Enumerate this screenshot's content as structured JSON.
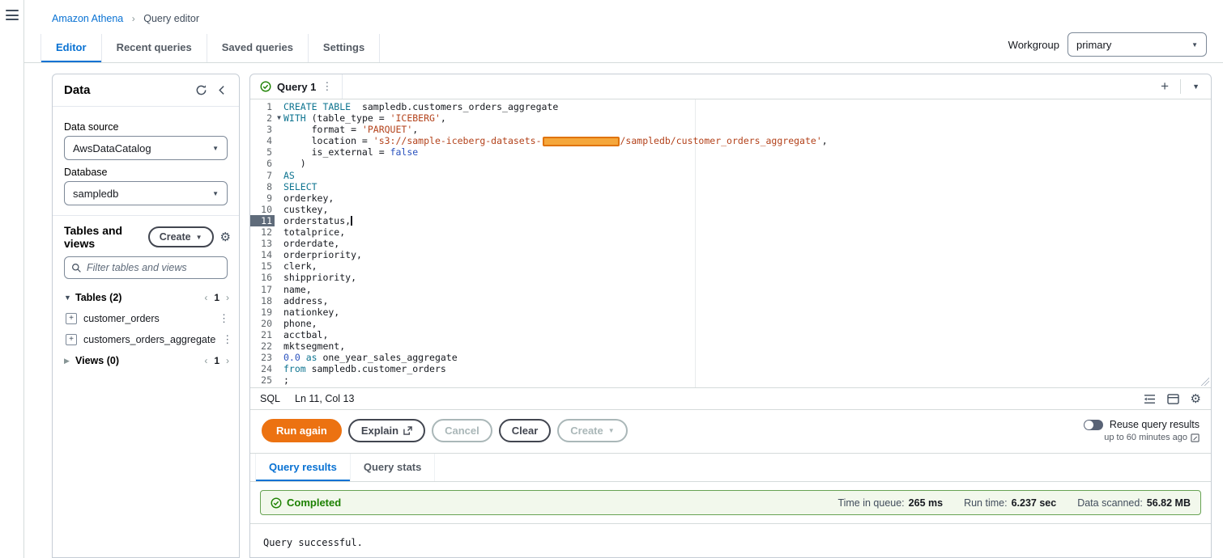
{
  "colors": {
    "accent": "#0972d3",
    "run_button": "#ec7211",
    "success": "#1d8102",
    "redaction": "#f5a73b"
  },
  "breadcrumb": {
    "items": [
      {
        "label": "Amazon Athena"
      },
      {
        "label": "Query editor"
      }
    ]
  },
  "top_tabs": {
    "items": [
      {
        "label": "Editor",
        "active": true
      },
      {
        "label": "Recent queries",
        "active": false
      },
      {
        "label": "Saved queries",
        "active": false
      },
      {
        "label": "Settings",
        "active": false
      }
    ]
  },
  "workgroup": {
    "label": "Workgroup",
    "value": "primary"
  },
  "data_panel": {
    "title": "Data",
    "data_source": {
      "label": "Data source",
      "value": "AwsDataCatalog"
    },
    "database": {
      "label": "Database",
      "value": "sampledb"
    },
    "tables_and_views": {
      "title": "Tables and views",
      "create_button": "Create",
      "filter_placeholder": "Filter tables and views",
      "tables_header": {
        "label": "Tables",
        "count": "(2)",
        "page": "1"
      },
      "tables": [
        {
          "name": "customer_orders"
        },
        {
          "name": "customers_orders_aggregate"
        }
      ],
      "views_header": {
        "label": "Views",
        "count": "(0)",
        "page": "1"
      }
    }
  },
  "editor": {
    "tab_label": "Query 1",
    "language": "SQL",
    "cursor_position": "Ln 11, Col 13",
    "active_line": 11,
    "code_lines": [
      {
        "n": 1,
        "segments": [
          {
            "t": "CREATE TABLE",
            "c": "kw"
          },
          {
            "t": "  sampledb.customers_orders_aggregate",
            "c": "p"
          }
        ]
      },
      {
        "n": 2,
        "fold": true,
        "segments": [
          {
            "t": "WITH",
            "c": "kw"
          },
          {
            "t": " (table_type = ",
            "c": "p"
          },
          {
            "t": "'ICEBERG'",
            "c": "str"
          },
          {
            "t": ",",
            "c": "p"
          }
        ]
      },
      {
        "n": 3,
        "segments": [
          {
            "t": "     format = ",
            "c": "p"
          },
          {
            "t": "'PARQUET'",
            "c": "str"
          },
          {
            "t": ",",
            "c": "p"
          }
        ]
      },
      {
        "n": 4,
        "segments": [
          {
            "t": "     location = ",
            "c": "p"
          },
          {
            "t": "'s3://sample-iceberg-datasets-",
            "c": "str"
          },
          {
            "t": "",
            "c": "redact"
          },
          {
            "t": "/sampledb/customer_orders_aggregate'",
            "c": "str"
          },
          {
            "t": ",",
            "c": "p"
          }
        ]
      },
      {
        "n": 5,
        "segments": [
          {
            "t": "     is_external = ",
            "c": "p"
          },
          {
            "t": "false",
            "c": "num"
          }
        ]
      },
      {
        "n": 6,
        "segments": [
          {
            "t": "   )",
            "c": "p"
          }
        ]
      },
      {
        "n": 7,
        "segments": [
          {
            "t": "AS",
            "c": "kw"
          }
        ]
      },
      {
        "n": 8,
        "segments": [
          {
            "t": "SELECT",
            "c": "kw"
          }
        ]
      },
      {
        "n": 9,
        "segments": [
          {
            "t": "orderkey,",
            "c": "p"
          }
        ]
      },
      {
        "n": 10,
        "segments": [
          {
            "t": "custkey,",
            "c": "p"
          }
        ]
      },
      {
        "n": 11,
        "segments": [
          {
            "t": "orderstatus,",
            "c": "p",
            "cursor": true
          }
        ]
      },
      {
        "n": 12,
        "segments": [
          {
            "t": "totalprice,",
            "c": "p"
          }
        ]
      },
      {
        "n": 13,
        "segments": [
          {
            "t": "orderdate,",
            "c": "p"
          }
        ]
      },
      {
        "n": 14,
        "segments": [
          {
            "t": "orderpriority,",
            "c": "p"
          }
        ]
      },
      {
        "n": 15,
        "segments": [
          {
            "t": "clerk,",
            "c": "p"
          }
        ]
      },
      {
        "n": 16,
        "segments": [
          {
            "t": "shippriority,",
            "c": "p"
          }
        ]
      },
      {
        "n": 17,
        "segments": [
          {
            "t": "name,",
            "c": "p"
          }
        ]
      },
      {
        "n": 18,
        "segments": [
          {
            "t": "address,",
            "c": "p"
          }
        ]
      },
      {
        "n": 19,
        "segments": [
          {
            "t": "nationkey,",
            "c": "p"
          }
        ]
      },
      {
        "n": 20,
        "segments": [
          {
            "t": "phone,",
            "c": "p"
          }
        ]
      },
      {
        "n": 21,
        "segments": [
          {
            "t": "acctbal,",
            "c": "p"
          }
        ]
      },
      {
        "n": 22,
        "segments": [
          {
            "t": "mktsegment,",
            "c": "p"
          }
        ]
      },
      {
        "n": 23,
        "segments": [
          {
            "t": "0.0",
            "c": "num"
          },
          {
            "t": " as ",
            "c": "kw"
          },
          {
            "t": "one_year_sales_aggregate",
            "c": "p"
          }
        ]
      },
      {
        "n": 24,
        "segments": [
          {
            "t": "from",
            "c": "kw"
          },
          {
            "t": " sampledb.customer_orders",
            "c": "p"
          }
        ]
      },
      {
        "n": 25,
        "segments": [
          {
            "t": ";",
            "c": "p"
          }
        ]
      }
    ]
  },
  "actions": {
    "run": "Run again",
    "explain": "Explain",
    "cancel": "Cancel",
    "clear": "Clear",
    "create": "Create",
    "reuse": {
      "label": "Reuse query results",
      "sub": "up to 60 minutes ago"
    }
  },
  "results": {
    "tabs": [
      {
        "label": "Query results",
        "active": true
      },
      {
        "label": "Query stats",
        "active": false
      }
    ],
    "status": "Completed",
    "metrics": [
      {
        "label": "Time in queue:",
        "value": "265 ms"
      },
      {
        "label": "Run time:",
        "value": "6.237 sec"
      },
      {
        "label": "Data scanned:",
        "value": "56.82 MB"
      }
    ],
    "message": "Query successful."
  }
}
